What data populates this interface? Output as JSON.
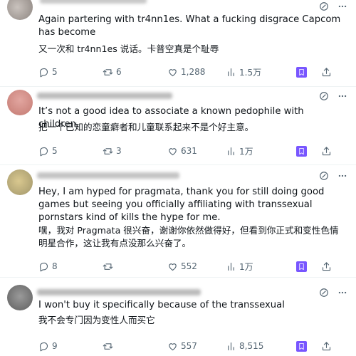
{
  "colors": {
    "text": "#0f1419",
    "muted": "#536471",
    "bookmark": "#7856ff",
    "divider": "#eff3f4"
  },
  "icons": {
    "top_right": [
      "edit-icon",
      "more-icon"
    ],
    "actions": [
      "reply-icon",
      "retweet-icon",
      "like-icon",
      "views-icon",
      "bookmark-icon",
      "share-icon"
    ]
  },
  "replies": [
    {
      "text_en": "Again partering with tr4nn1es. What a fucking disgrace Capcom has become",
      "text_zh": "又一次和 tr4nn1es 说话。卡普空真是个耻辱",
      "replies": "5",
      "retweets": "6",
      "likes": "1,288",
      "views": "1.5万"
    },
    {
      "text_en": "It’s not a good idea to associate a known pedophile with children.",
      "text_zh": "把一个已知的恋童癖者和儿童联系起来不是个好主意。",
      "replies": "5",
      "retweets": "3",
      "likes": "631",
      "views": "1万"
    },
    {
      "text_en": "Hey, I am hyped for pragmata, thank you for still doing good games but seeing you officially affiliating with transsexual pornstars kind of kills the hype for me.",
      "text_zh": "嘿，我对 Pragmata 很兴奋，谢谢你依然做得好，但看到你正式和变性色情明星合作，这让我有点没那么兴奋了。",
      "replies": "8",
      "retweets": "",
      "likes": "552",
      "views": "1万"
    },
    {
      "text_en": "I won't buy it specifically because of the transsexual",
      "text_zh": "我不会专门因为变性人而买它",
      "replies": "9",
      "retweets": "",
      "likes": "557",
      "views": "8,515"
    }
  ]
}
